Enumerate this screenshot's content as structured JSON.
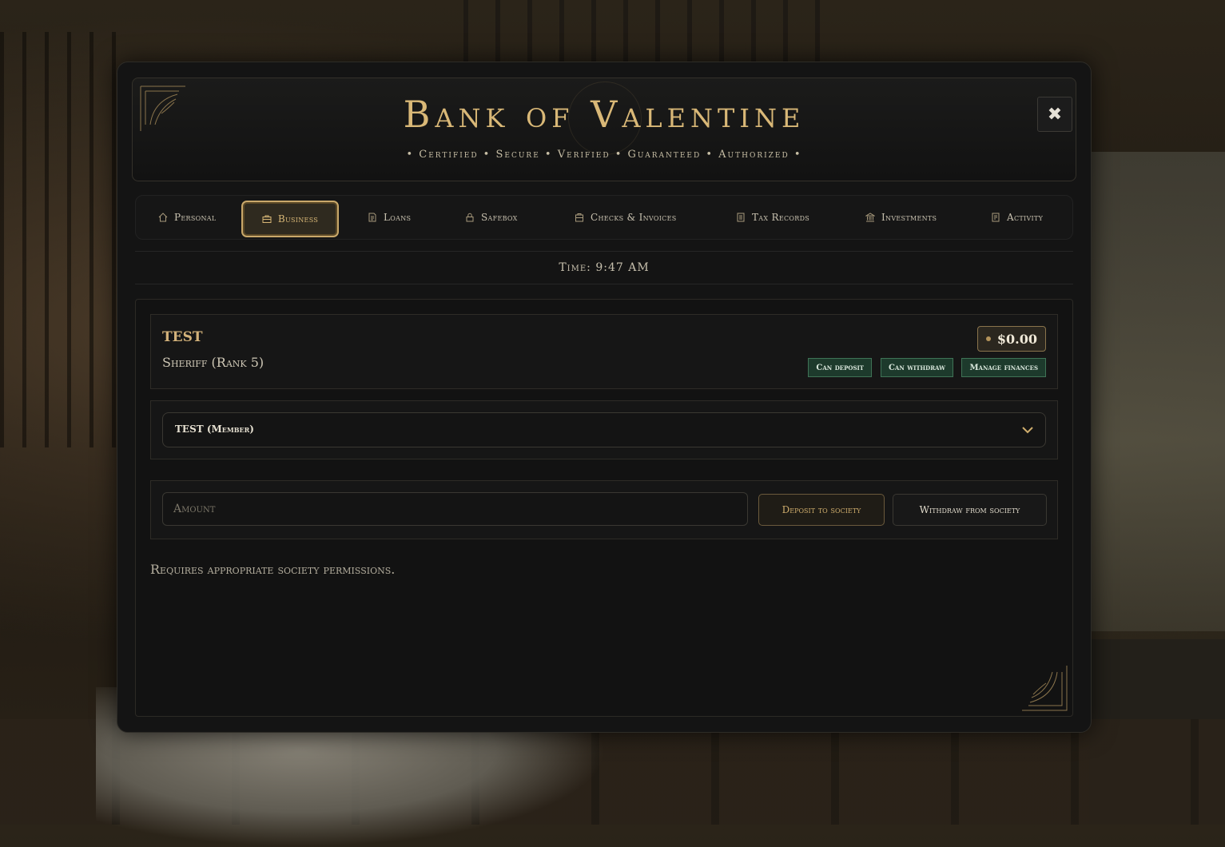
{
  "header": {
    "title": "Bank of Valentine",
    "subtitle": "• Certified • Secure • Verified • Guaranteed • Authorized •",
    "close_label": "✖"
  },
  "tabs": [
    {
      "label": "Personal",
      "icon": "house-icon"
    },
    {
      "label": "Business",
      "icon": "briefcase-icon",
      "active": true
    },
    {
      "label": "Loans",
      "icon": "document-icon"
    },
    {
      "label": "Safebox",
      "icon": "lock-icon"
    },
    {
      "label": "Checks & Invoices",
      "icon": "receipt-icon"
    },
    {
      "label": "Tax Records",
      "icon": "ledger-icon"
    },
    {
      "label": "Investments",
      "icon": "bank-icon"
    },
    {
      "label": "Activity",
      "icon": "list-icon"
    }
  ],
  "time": "Time: 9:47 AM",
  "business": {
    "name": "TEST",
    "role": "Sheriff (Rank 5)",
    "balance": "$0.00",
    "permissions": [
      "Can deposit",
      "Can withdraw",
      "Manage finances"
    ]
  },
  "society_select": {
    "selected": "TEST (Member)"
  },
  "transaction": {
    "amount_placeholder": "Amount",
    "deposit_label": "Deposit to society",
    "withdraw_label": "Withdraw from society"
  },
  "note": "Requires appropriate society permissions.",
  "colors": {
    "accent_gold": "#d9b877",
    "permission_green": "#1d3a2c",
    "panel_bg": "#141414"
  }
}
